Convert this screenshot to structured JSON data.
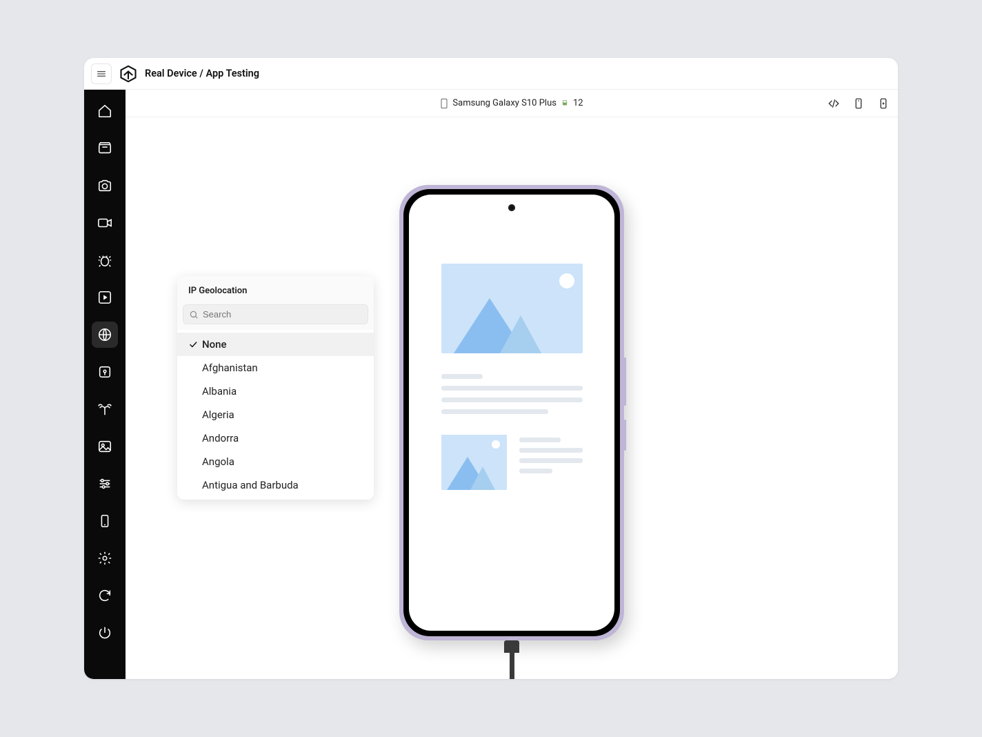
{
  "header": {
    "breadcrumb": "Real Device / App Testing"
  },
  "deviceBar": {
    "device_name": "Samsung Galaxy S10 Plus",
    "os_version": "12"
  },
  "sidebar": {
    "items": [
      {
        "name": "home"
      },
      {
        "name": "app"
      },
      {
        "name": "camera"
      },
      {
        "name": "video"
      },
      {
        "name": "bug"
      },
      {
        "name": "play-record"
      },
      {
        "name": "globe",
        "active": true
      },
      {
        "name": "location-marker"
      },
      {
        "name": "network"
      },
      {
        "name": "image"
      },
      {
        "name": "sliders"
      },
      {
        "name": "device"
      },
      {
        "name": "settings"
      },
      {
        "name": "refresh"
      },
      {
        "name": "power"
      }
    ]
  },
  "geoPanel": {
    "title": "IP Geolocation",
    "search_placeholder": "Search",
    "items": [
      {
        "label": "None",
        "selected": true
      },
      {
        "label": "Afghanistan"
      },
      {
        "label": "Albania"
      },
      {
        "label": "Algeria"
      },
      {
        "label": "Andorra"
      },
      {
        "label": "Angola"
      },
      {
        "label": "Antigua and Barbuda"
      }
    ]
  }
}
